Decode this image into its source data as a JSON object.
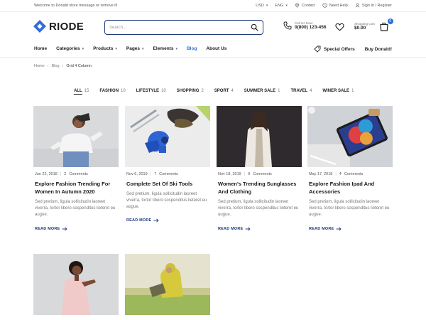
{
  "topbar": {
    "welcome": "Welcome to Donald store message or remove it!",
    "currency": "USD",
    "language": "ENG",
    "contact": "Contact",
    "help": "Need Help",
    "auth": "Sign In / Register"
  },
  "header": {
    "logo": "RIODE",
    "search_placeholder": "Search...",
    "call_label": "Call Us Now:",
    "call_number": "0(800) 123-456",
    "cart_label": "Shopping Cart",
    "cart_total": "$0.00",
    "cart_count": "0"
  },
  "nav": {
    "items": [
      {
        "label": "Home"
      },
      {
        "label": "Categories",
        "caret": true
      },
      {
        "label": "Products",
        "caret": true
      },
      {
        "label": "Pages",
        "caret": true
      },
      {
        "label": "Elements",
        "caret": true
      },
      {
        "label": "Blog",
        "active": true
      },
      {
        "label": "About Us"
      }
    ],
    "special_offers": "Special Offers",
    "buy": "Buy Donald!"
  },
  "breadcrumb": {
    "home": "Home",
    "blog": "Blog",
    "current": "Grid 4 Column"
  },
  "filters": [
    {
      "name": "ALL",
      "count": "15",
      "active": true
    },
    {
      "name": "FASHION",
      "count": "10"
    },
    {
      "name": "LIFESTYLE",
      "count": "10"
    },
    {
      "name": "SHOPPING",
      "count": "2"
    },
    {
      "name": "SPORT",
      "count": "4"
    },
    {
      "name": "SUMMER SALE",
      "count": "1"
    },
    {
      "name": "TRAVEL",
      "count": "4"
    },
    {
      "name": "WINER SALE",
      "count": "1"
    }
  ],
  "posts": [
    {
      "date": "Jun 22, 2018",
      "comments": "2",
      "comments_label": "Comments",
      "title": "Explore Fashion Trending For Women In Autumn 2020",
      "excerpt": "Sed pretium, ligula sollicitudin laoreet viverra, tortor libero sospenditus lieteret eu augue.",
      "more": "READ MORE"
    },
    {
      "date": "Nov 6, 2019",
      "comments": "7",
      "comments_label": "Comments",
      "title": "Complete Set Of Ski Tools",
      "excerpt": "Sed pretium, ligula sollicitudin laoreet viverra, tortor libero sospenditus lieteret eu augue.",
      "more": "READ MORE"
    },
    {
      "date": "Nov 18, 2019",
      "comments": "9",
      "comments_label": "Comments",
      "title": "Women's Trending Sunglasses And Clothing",
      "excerpt": "Sed pretium, ligula sollicitudin laoreet viverra, tortor libero sospenditus lieteret eu augue.",
      "more": "READ MORE"
    },
    {
      "date": "May 17, 2018",
      "comments": "4",
      "comments_label": "Comments",
      "title": "Explore Fashion Ipad And Accessories",
      "excerpt": "Sed pretium, ligula sollicitudin laoreet viverra, tortor libero sospenditus lieteret eu augue.",
      "more": "READ MORE"
    }
  ],
  "colors": {
    "accent": "#2e6fd7",
    "brand_dark": "#1c3a7a"
  }
}
